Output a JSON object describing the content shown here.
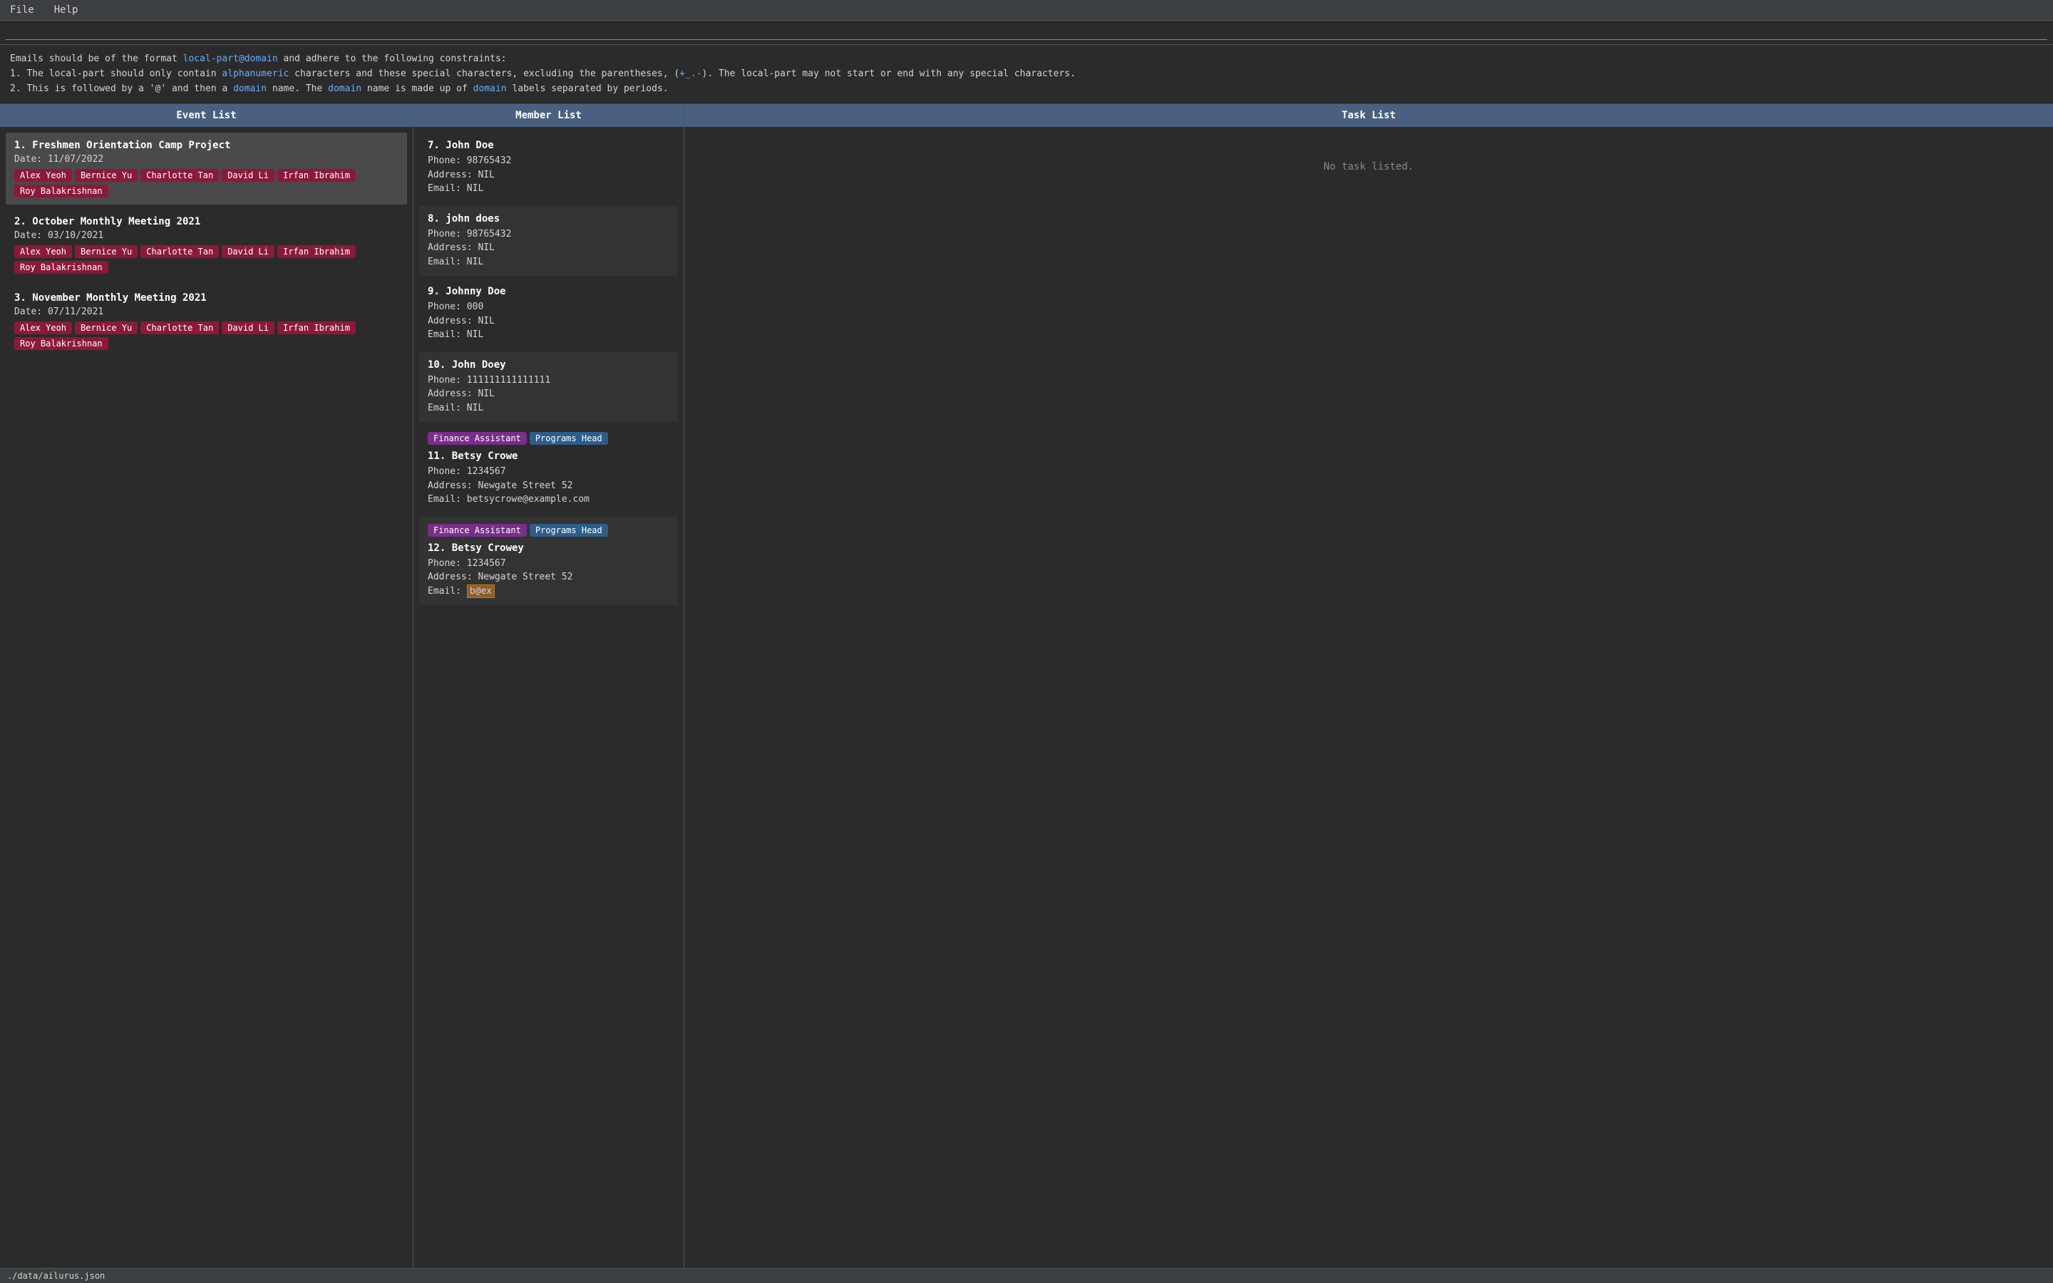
{
  "menu": {
    "file_label": "File",
    "help_label": "Help"
  },
  "command": {
    "placeholder": ""
  },
  "info": {
    "line1": "Emails should be of the format local-part@domain and adhere to the following constraints:",
    "line2": "1. The local-part should only contain alphanumeric characters and these special characters, excluding the parentheses, (+_.-). The local-part may not start or end with any special characters.",
    "line3": "2. This is followed by a '@' and then a domain name. The domain name is made up of domain labels separated by periods."
  },
  "event_panel": {
    "header": "Event List",
    "events": [
      {
        "number": "1.",
        "title": "Freshmen Orientation Camp Project",
        "date": "Date: 11/07/2022",
        "tags": [
          "Alex Yeoh",
          "Bernice Yu",
          "Charlotte Tan",
          "David Li",
          "Irfan Ibrahim",
          "Roy Balakrishnan"
        ],
        "selected": true
      },
      {
        "number": "2.",
        "title": "October Monthly Meeting 2021",
        "date": "Date: 03/10/2021",
        "tags": [
          "Alex Yeoh",
          "Bernice Yu",
          "Charlotte Tan",
          "David Li",
          "Irfan Ibrahim",
          "Roy Balakrishnan"
        ],
        "selected": false
      },
      {
        "number": "3.",
        "title": "November Monthly Meeting 2021",
        "date": "Date: 07/11/2021",
        "tags": [
          "Alex Yeoh",
          "Bernice Yu",
          "Charlotte Tan",
          "David Li",
          "Irfan Ibrahim",
          "Roy Balakrishnan"
        ],
        "selected": false
      }
    ]
  },
  "member_panel": {
    "header": "Member List",
    "members": [
      {
        "number": "7.",
        "name": "John Doe",
        "phone": "Phone: 98765432",
        "address": "Address: NIL",
        "email": "Email: NIL",
        "roles": [],
        "email_highlight": false,
        "alt": false
      },
      {
        "number": "8.",
        "name": "john does",
        "phone": "Phone: 98765432",
        "address": "Address: NIL",
        "email": "Email: NIL",
        "roles": [],
        "email_highlight": false,
        "alt": true
      },
      {
        "number": "9.",
        "name": "Johnny Doe",
        "phone": "Phone: 000",
        "address": "Address: NIL",
        "email": "Email: NIL",
        "roles": [],
        "email_highlight": false,
        "alt": false
      },
      {
        "number": "10.",
        "name": "John Doey",
        "phone": "Phone: 111111111111111",
        "address": "Address: NIL",
        "email": "Email: NIL",
        "roles": [],
        "email_highlight": false,
        "alt": true
      },
      {
        "number": "11.",
        "name": "Betsy Crowe",
        "phone": "Phone: 1234567",
        "address": "Address: Newgate   Street 52",
        "email": "Email: betsycrowe@example.com",
        "roles": [
          "Finance Assistant",
          "Programs Head"
        ],
        "email_highlight": false,
        "alt": false
      },
      {
        "number": "12.",
        "name": "Betsy Crowey",
        "phone": "Phone: 1234567",
        "address": "Address: Newgate   Street 52",
        "email_prefix": "Email: ",
        "email_highlighted": "b@ex",
        "roles": [
          "Finance Assistant",
          "Programs Head"
        ],
        "email_highlight": true,
        "alt": true
      }
    ]
  },
  "task_panel": {
    "header": "Task List",
    "no_task_label": "No task listed."
  },
  "status_bar": {
    "path": "./data/ailurus.json"
  }
}
